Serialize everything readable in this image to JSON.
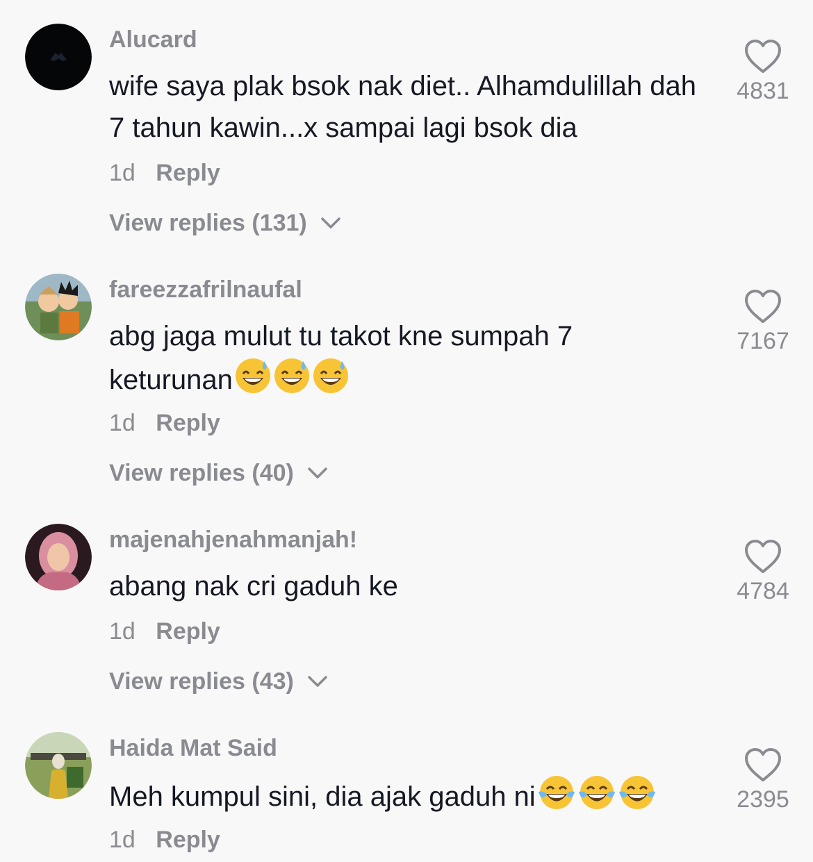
{
  "comments": [
    {
      "username": "Alucard",
      "text": "wife saya plak bsok nak diet.. Alhamdulillah dah 7 tahun kawin...x sampai lagi bsok dia",
      "emojis": [],
      "time": "1d",
      "reply": "Reply",
      "view_replies": "View replies (131)",
      "likes": "4831",
      "avatar_icon": "dark-silhouette-avatar"
    },
    {
      "username": "fareezzafrilnaufal",
      "text": "abg jaga mulut tu takot kne sumpah 7 keturunan",
      "emojis": [
        "grinning-sweat-emoji",
        "grinning-sweat-emoji",
        "grinning-sweat-emoji"
      ],
      "time": "1d",
      "reply": "Reply",
      "view_replies": "View replies (40)",
      "likes": "7167",
      "avatar_icon": "anime-characters-avatar"
    },
    {
      "username": "majenahjenahmanjah!",
      "text": "abang nak cri gaduh ke",
      "emojis": [],
      "time": "1d",
      "reply": "Reply",
      "view_replies": "View replies (43)",
      "likes": "4784",
      "avatar_icon": "woman-hijab-avatar"
    },
    {
      "username": "Haida Mat Said",
      "text": "Meh kumpul sini, dia ajak gaduh ni",
      "emojis": [
        "tears-of-joy-emoji",
        "tears-of-joy-emoji",
        "tears-of-joy-emoji"
      ],
      "time": "1d",
      "reply": "Reply",
      "view_replies": "",
      "likes": "2395",
      "avatar_icon": "outdoor-photo-avatar"
    }
  ],
  "colors": {
    "background": "#f8f8f8",
    "username": "#8a8b91",
    "text": "#161823",
    "muted": "#8a8b91"
  }
}
